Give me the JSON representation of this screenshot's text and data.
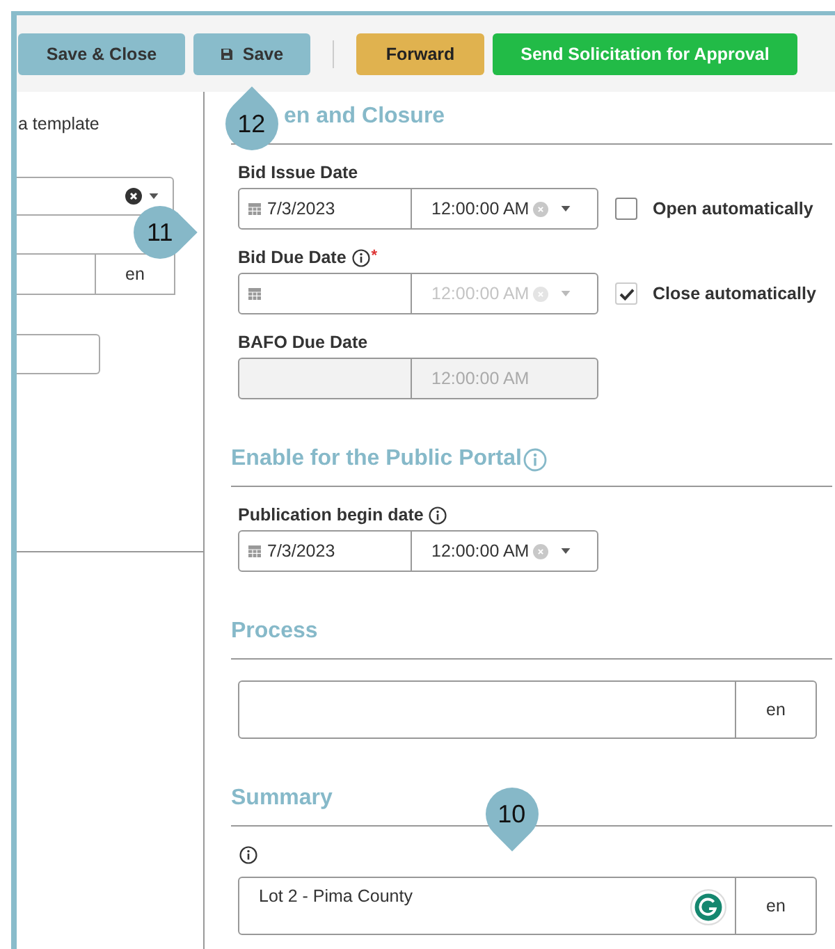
{
  "toolbar": {
    "buttons": [
      {
        "label": "Save & Close",
        "kind": "secondary"
      },
      {
        "label": "Save",
        "kind": "save"
      },
      {
        "label": "Forward",
        "kind": "warning"
      },
      {
        "label": "Send Solicitation for Approval",
        "kind": "success"
      }
    ]
  },
  "left_panel": {
    "template_text": "a template",
    "language": "en"
  },
  "opening": {
    "title": "en and Closure",
    "fields": [
      {
        "kind": "picker",
        "label": "Bid Issue Date",
        "info": false,
        "date": "7/3/2023",
        "time": "12:00:00 AM",
        "time_disabled": false,
        "checkbox": {
          "label": "Open automatically",
          "checked": false
        }
      },
      {
        "kind": "picker",
        "label": "Bid Due Date",
        "info": true,
        "required_mark": "*",
        "time": "12:00:00 AM",
        "time_disabled": true,
        "checkbox": {
          "label": "Close automatically",
          "checked": true
        }
      },
      {
        "kind": "locked",
        "label": "BAFO Due Date",
        "info": false,
        "time": "12:00:00 AM"
      }
    ]
  },
  "portal": {
    "title": "Enable for the Public Portal",
    "fields": [
      {
        "kind": "picker",
        "label": "Publication begin date",
        "info": true,
        "date": "7/3/2023",
        "time": "12:00:00 AM",
        "time_disabled": false
      }
    ]
  },
  "process": {
    "title": "Process",
    "language": "en"
  },
  "summary": {
    "title": "Summary",
    "value": "Lot 2 - Pima County",
    "language": "en"
  },
  "markers": [
    {
      "label": "12",
      "kind": "up"
    },
    {
      "label": "11",
      "kind": "right"
    },
    {
      "label": "10",
      "kind": "down"
    }
  ]
}
